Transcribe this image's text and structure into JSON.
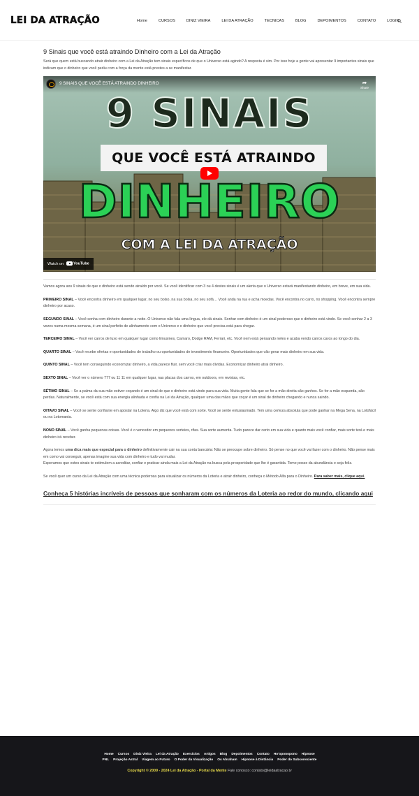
{
  "header": {
    "logo": "LEI DA ATRAÇÃO",
    "nav": [
      "Home",
      "Cursos",
      "Diniz Vieira",
      "Lei da Atração",
      "Tecnicas",
      "Blog",
      "Depoimentos",
      "Contato",
      "Login"
    ]
  },
  "article": {
    "title": "9 Sinais que você está atraindo Dinheiro com a Lei da Atração",
    "intro": "Será que quem está buscando atrair dinheiro com a Lei da Atração tem sinais específicos de que o Universo está agindo? A resposta é sim. Por isso hoje a gente vai apresentar 9 importantes sinais que indicam que o dinheiro que você pediu com a força da mente está prestes a se manifestar.",
    "video": {
      "title": "9 SINAIS QUE VOCÊ ESTÁ ATRAINDO DINHEIRO",
      "share_label": "Share",
      "watch_on": "Watch on",
      "youtube": "YouTube",
      "thumb_line1": "9 SINAIS",
      "thumb_line2": "QUE VOCÊ ESTÁ ATRAINDO",
      "thumb_line3": "DINHEIRO",
      "thumb_line4": "COM A LEI DA ATRAÇÃO"
    },
    "lead": "Vamos agora aos 9 sinais de que o dinheiro está sendo atraído por você. Se você identificar com 3 ou 4 destes sinais é um alerta que o Universo estará manifestando dinheiro, em breve, em sua vida.",
    "signals": [
      {
        "label": "PRIMEIRO SINAL",
        "text": " – Você encontra dinheiro em qualquer lugar, no seu bolso, na sua bolsa, no seu sofá… Você anda na rua e acha moedas. Você encontra no carro, no shopping. Você encontra sempre dinheiro por acaso."
      },
      {
        "label": "SEGUNDO SINAL",
        "text": " – Você sonha com dinheiro durante a noite. O Universo não fala uma língua, ele dá sinais. Sonhar com dinheiro é um sinal poderoso que o dinheiro está vindo. Se você sonhar 2 a 3 vezes numa mesma semana, é um sinal perfeito de alinhamento com o Universo e o dinheiro que você precisa está para chegar."
      },
      {
        "label": "TERCEIRO SINAL",
        "text": " – Você ver carros de luxo em qualquer lugar como limusines, Camaro, Dodge RAM, Ferrari, etc. Você nem está pensando neles e acaba vendo carros caros ao longo do dia."
      },
      {
        "label": "QUARTO SINAL",
        "text": " – Você recebe ofertas e oportunidades de trabalho ou oportunidades de investimento financeiro. Oportunidades que vão gerar mais dinheiro em sua vida."
      },
      {
        "label": "QUINTO SINAL",
        "text": " – Você tem conseguindo economizar dinheiro, a vida parece fluir, sem você criar mais dívidas. Economizar dinheiro atrai dinheiro."
      },
      {
        "label": "SEXTO SINAL",
        "text": " – Você ver o número 777 ou 11 11 em qualquer lugar, nas placas dos carros, em outdoors, em revistas, etc."
      },
      {
        "label": "SÉTIMO SINAL",
        "text": " – Se a palma da sua mão estiver coçando é um sinal de que o dinheiro está vindo para sua vida. Muita gente fala que se for a mão direita são ganhos. Se for a mão esquerda, são perdas. Naturalmente, se você está com sua energia alinhada e confia na Lei da Atração, qualquer uma das mãos que coçar é um sinal de dinheiro chegando e nunca saindo."
      },
      {
        "label": "OITAVO SINAL",
        "text": " – Você se sente confiante em apostar na Loteria. Algo diz que você está com sorte. Você se sente entusiasmado. Tem uma certeza absoluta que pode ganhar na Mega Sena, na Lotofácil ou na Lotomania."
      },
      {
        "label": "NONO SINAL",
        "text": " – Você ganha pequenas coisas. Você é o vencedor em pequenos sorteios, rifas. Sua sorte aumenta. Tudo parece dar certo em sua vida e quanto mais você confiar, mais sorte terá e mais dinheiro irá receber."
      }
    ],
    "tip_pre": "Agora temos ",
    "tip_bold": "uma dica mais que especial para o dinheiro",
    "tip_post": " definitivamente cair na sua conta bancária: Não se preocupe sobre dinheiro. Só pense no que você vai fazer com o dinheiro. Não pense mais em como vai conseguir, apenas imagine sua vida com dinheiro e tudo vai mudar.",
    "hope": "Esperamos que estes sinais te estimulem a acreditar, confiar e praticar ainda mais a Lei da Atração na busca pela prosperidade que lhe é garantida. Tome posse da abundância e seja feliz.",
    "course_pre": "Se você quer um curso da Lei da Atração com uma técnica poderosa para visualizar os números da Loteria e atrair dinheiro, conheça o Método Alfa para o Dinheiro. ",
    "course_link": "Para saber mais, clique aqui.",
    "cta": "Conheça 5 histórias incríveis de pessoas que sonharam com os números da Loteria ao redor do mundo, clicando aqui"
  },
  "footer": {
    "row1": [
      "Home",
      "Cursos",
      "Diniz Vieira",
      "Lei da Atração",
      "Exercícios",
      "Artigos",
      "Blog",
      "Depoimentos",
      "Contato",
      "Ho'oponopono",
      "Hipnose"
    ],
    "row2": [
      "PNL",
      "Projeção Astral",
      "Viagem ao Futuro",
      "O Poder da Visualização",
      "Os Abraham",
      "Hipnose à Distância",
      "Poder do Subconsciente"
    ],
    "copyright": "Copyright © 2009 - 2024 Lei da Atração - Portal da Mente",
    "contact": " Fale conosco: contato@leidaatracao.tv"
  },
  "colors": {
    "footer_bg": "#16161a",
    "accent_yellow": "#e5d84a",
    "thumb_green": "#2bd156",
    "play_red": "#ff0000"
  }
}
